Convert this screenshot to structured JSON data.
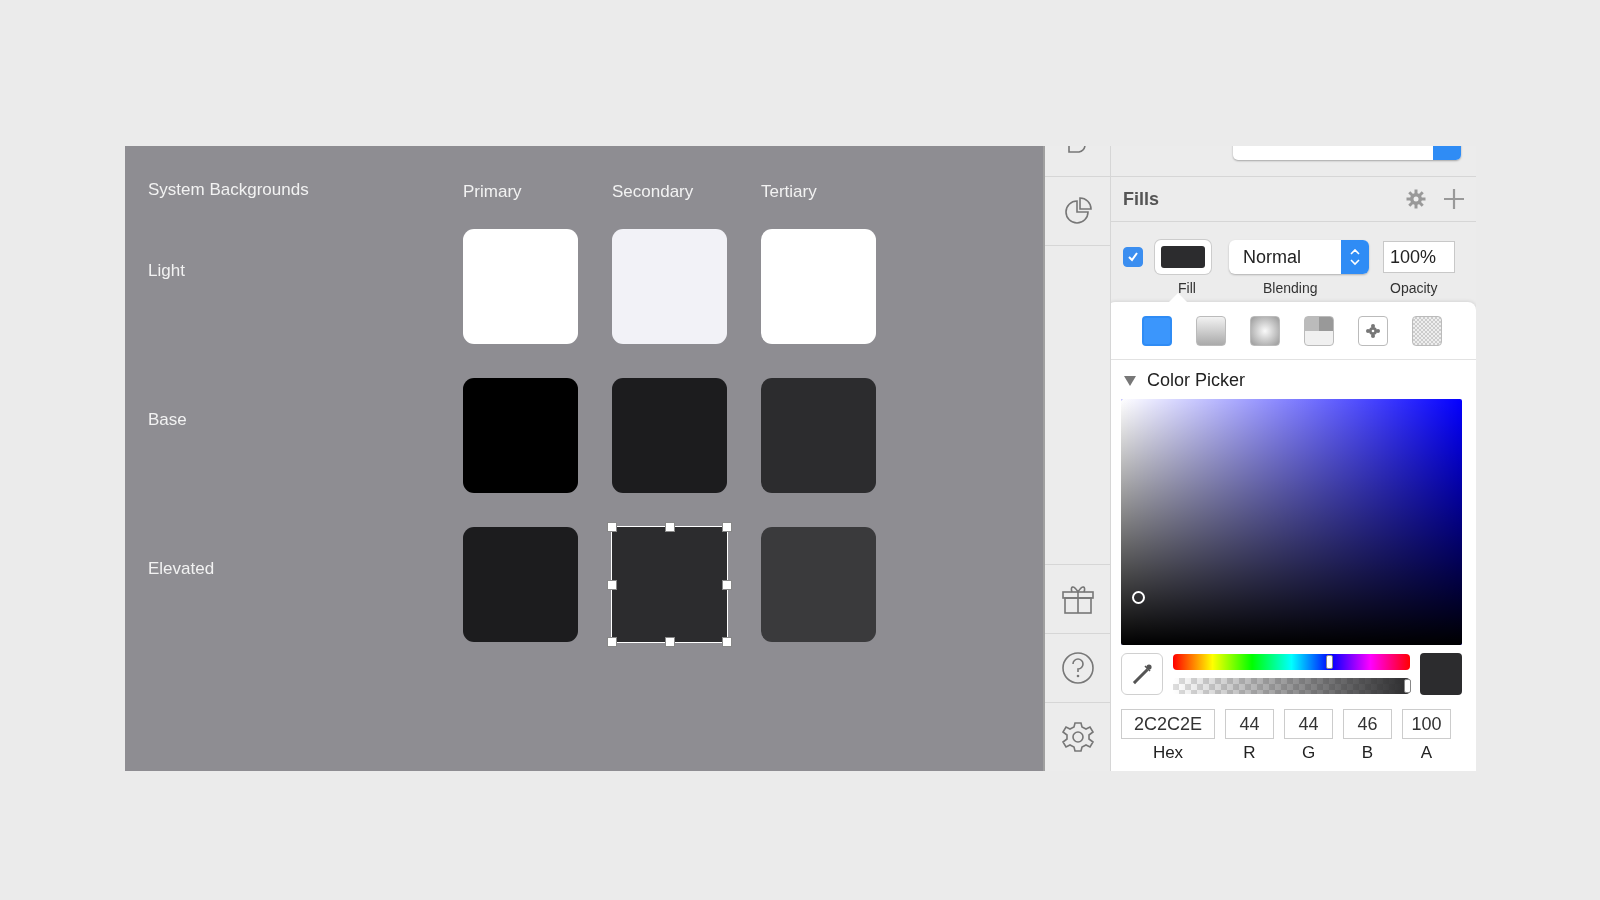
{
  "canvas": {
    "title": "System Backgrounds",
    "columns": [
      "Primary",
      "Secondary",
      "Tertiary"
    ],
    "rows": [
      {
        "label": "Light",
        "swatches": [
          {
            "color": "#ffffff",
            "selected": false
          },
          {
            "color": "#f2f2f7",
            "selected": false
          },
          {
            "color": "#ffffff",
            "selected": false
          }
        ]
      },
      {
        "label": "Base",
        "swatches": [
          {
            "color": "#000000",
            "selected": false
          },
          {
            "color": "#1c1c1e",
            "selected": false
          },
          {
            "color": "#2c2c2e",
            "selected": false
          }
        ]
      },
      {
        "label": "Elevated",
        "swatches": [
          {
            "color": "#1c1c1e",
            "selected": false
          },
          {
            "color": "#2c2c2e",
            "selected": true
          },
          {
            "color": "#3a3a3c",
            "selected": false
          }
        ]
      }
    ]
  },
  "fills": {
    "title": "Fills",
    "fill": {
      "enabled": true,
      "color": "#2c2c2e",
      "blending": "Normal",
      "opacity": "100%"
    },
    "labels": {
      "fill": "Fill",
      "blending": "Blending",
      "opacity": "Opacity"
    }
  },
  "picker": {
    "fill_types": [
      {
        "kind": "solid",
        "selected": true
      },
      {
        "kind": "linear",
        "selected": false
      },
      {
        "kind": "radial",
        "selected": false
      },
      {
        "kind": "angular",
        "selected": false
      },
      {
        "kind": "pattern",
        "selected": false
      },
      {
        "kind": "noise",
        "selected": false
      }
    ],
    "section": {
      "title": "Color Picker",
      "expanded": true
    },
    "hue": {
      "level": 0.67
    },
    "alpha": {
      "level": 1
    },
    "fields": [
      {
        "label": "Hex",
        "value": "2C2C2E"
      },
      {
        "label": "R",
        "value": "44"
      },
      {
        "label": "G",
        "value": "44"
      },
      {
        "label": "B",
        "value": "46"
      },
      {
        "label": "A",
        "value": "100"
      }
    ]
  }
}
